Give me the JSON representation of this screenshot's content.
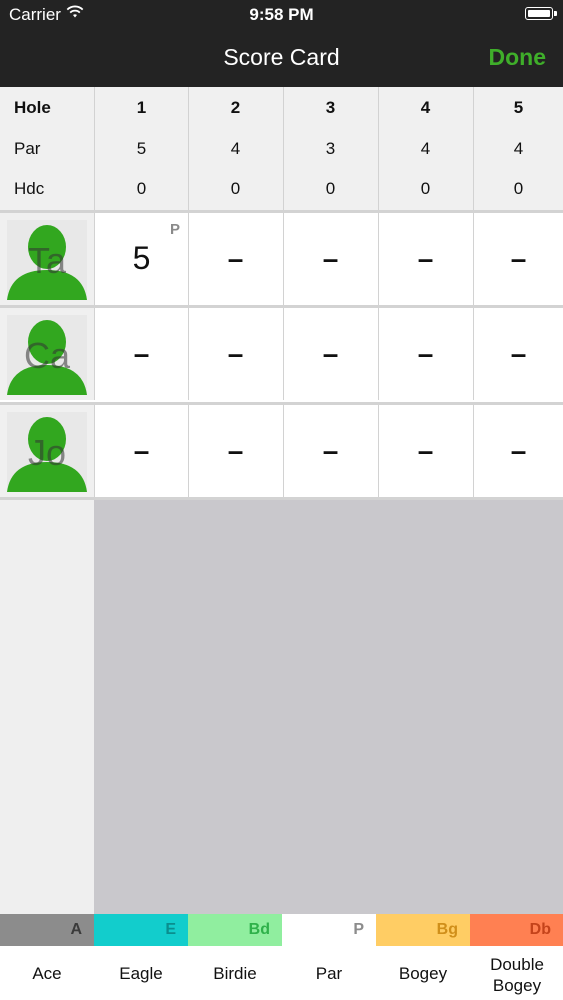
{
  "status_bar": {
    "carrier": "Carrier",
    "time": "9:58 PM"
  },
  "nav": {
    "title": "Score Card",
    "done_label": "Done"
  },
  "header": {
    "labels": {
      "hole": "Hole",
      "par": "Par",
      "hdc": "Hdc"
    },
    "holes": [
      {
        "hole": "1",
        "par": "5",
        "hdc": "0"
      },
      {
        "hole": "2",
        "par": "4",
        "hdc": "0"
      },
      {
        "hole": "3",
        "par": "3",
        "hdc": "0"
      },
      {
        "hole": "4",
        "par": "4",
        "hdc": "0"
      },
      {
        "hole": "5",
        "par": "4",
        "hdc": "0"
      }
    ]
  },
  "players": [
    {
      "initials": "Ta",
      "scores": [
        "5",
        "–",
        "–",
        "–",
        "–"
      ],
      "first_badge": "P"
    },
    {
      "initials": "Ca",
      "scores": [
        "–",
        "–",
        "–",
        "–",
        "–"
      ]
    },
    {
      "initials": "Jo",
      "scores": [
        "–",
        "–",
        "–",
        "–",
        "–"
      ]
    }
  ],
  "legend": [
    {
      "abbr": "A",
      "name": "Ace",
      "color": "#8c8c8c",
      "text_color": "#3b3b3b"
    },
    {
      "abbr": "E",
      "name": "Eagle",
      "color": "#12cdcc",
      "text_color": "#0a8e8e"
    },
    {
      "abbr": "Bd",
      "name": "Birdie",
      "color": "#90ee9f",
      "text_color": "#2fb14a"
    },
    {
      "abbr": "P",
      "name": "Par",
      "color": "#ffffff",
      "text_color": "#8c8c8c"
    },
    {
      "abbr": "Bg",
      "name": "Bogey",
      "color": "#ffcd64",
      "text_color": "#d08f1a"
    },
    {
      "abbr": "Db",
      "name": "Double Bogey",
      "color": "#ff8052",
      "text_color": "#c4431b"
    }
  ],
  "colors": {
    "accent": "#3fae2a",
    "bar": "#232323"
  }
}
